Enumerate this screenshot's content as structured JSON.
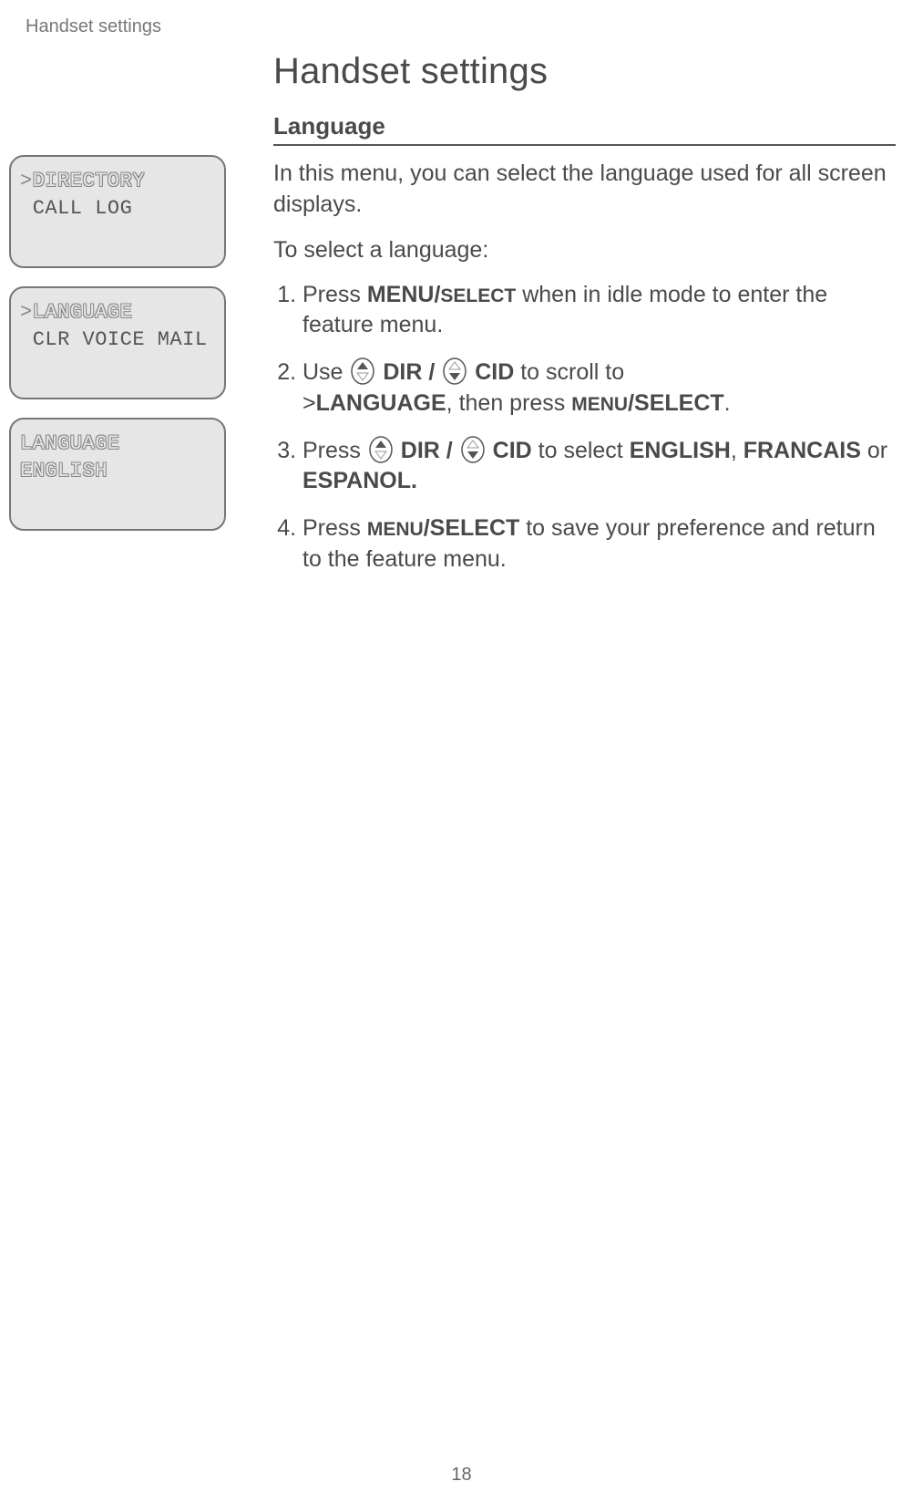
{
  "runningHead": "Handset settings",
  "title": "Handset settings",
  "section": "Language",
  "intro1": "In this menu, you can select the language used for all screen displays.",
  "intro2": "To select a language:",
  "steps": {
    "s1a": "Press ",
    "s1b": "MENU/",
    "s1c": "SELECT",
    "s1d": " when in idle mode to enter the feature menu.",
    "s2a": "Use ",
    "s2b": " DIR / ",
    "s2c": " CID",
    "s2d": "  to scroll to ",
    "s2e": ">",
    "s2f": "LANGUAGE",
    "s2g": ", then press ",
    "s2h": "MENU",
    "s2i": "/SELECT",
    "s2j": ".",
    "s3a": "Press ",
    "s3b": " DIR / ",
    "s3c": " CID",
    "s3d": "  to select ",
    "s3e": "ENGLISH",
    "s3f": ", ",
    "s3g": "FRANCAIS",
    "s3h": " or ",
    "s3i": "ESPANOL.",
    "s4a": "Press ",
    "s4b": "MENU",
    "s4c": "/SELECT",
    "s4d": " to save your preference and return to the feature menu."
  },
  "screens": [
    {
      "line1_prefix": ">",
      "line1": "DIRECTORY",
      "line2_prefix": " ",
      "line2": "CALL LOG",
      "line1_outline": true
    },
    {
      "line1_prefix": ">",
      "line1": "LANGUAGE",
      "line2_prefix": " ",
      "line2": "CLR VOICE MAIL",
      "line1_outline": true
    },
    {
      "line1_prefix": "",
      "line1": "LANGUAGE",
      "line2_prefix": "",
      "line2": "ENGLISH",
      "line1_outline": true
    }
  ],
  "pageNumber": "18"
}
